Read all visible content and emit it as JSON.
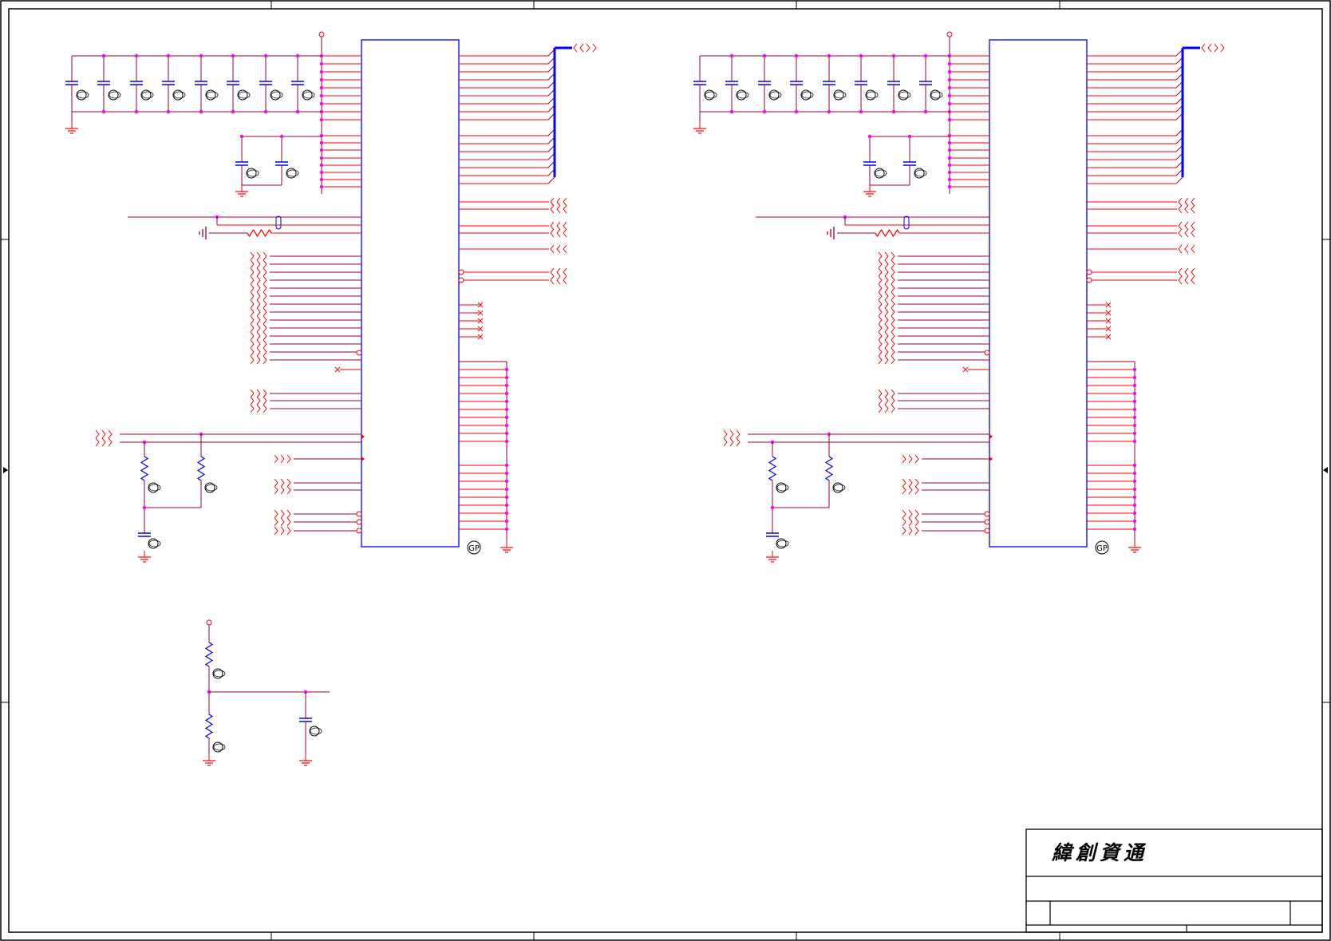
{
  "title_block": {
    "company": "緯創資通"
  },
  "symbols": {
    "gp_label": "GP"
  },
  "colors": {
    "wire": "#ff0000",
    "net": "#990033",
    "component": "#0000ff",
    "junction": "#ff00ff",
    "frame": "#000000"
  }
}
